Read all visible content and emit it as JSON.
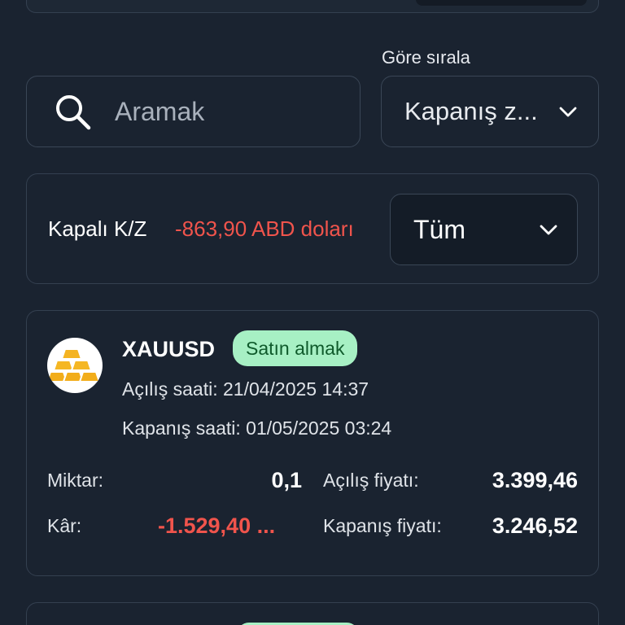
{
  "sort": {
    "label": "Göre sırala",
    "selected": "Kapanış z..."
  },
  "search": {
    "placeholder": "Aramak",
    "value": ""
  },
  "closed_pl": {
    "label": "Kapalı K/Z",
    "value": "-863,90 ABD doları",
    "filter_selected": "Tüm"
  },
  "trade": {
    "symbol": "XAUUSD",
    "side_badge": "Satın almak",
    "open_time": "Açılış saati: 21/04/2025 14:37",
    "close_time": "Kapanış saati: 01/05/2025 03:24",
    "quantity_label": "Miktar:",
    "quantity_value": "0,1",
    "profit_label": "Kâr:",
    "profit_value": "-1.529,40 ...",
    "open_price_label": "Açılış fiyatı:",
    "open_price_value": "3.399,46",
    "close_price_label": "Kapanış fiyatı:",
    "close_price_value": "3.246,52"
  },
  "colors": {
    "background": "#1a2330",
    "loss_red": "#f0544c",
    "buy_badge_bg": "#a7f0c4",
    "buy_badge_text": "#0f5a2b"
  },
  "icons": {
    "search": "search-icon",
    "dropdown": "chevron-down-icon",
    "asset": "gold-bars-icon"
  }
}
